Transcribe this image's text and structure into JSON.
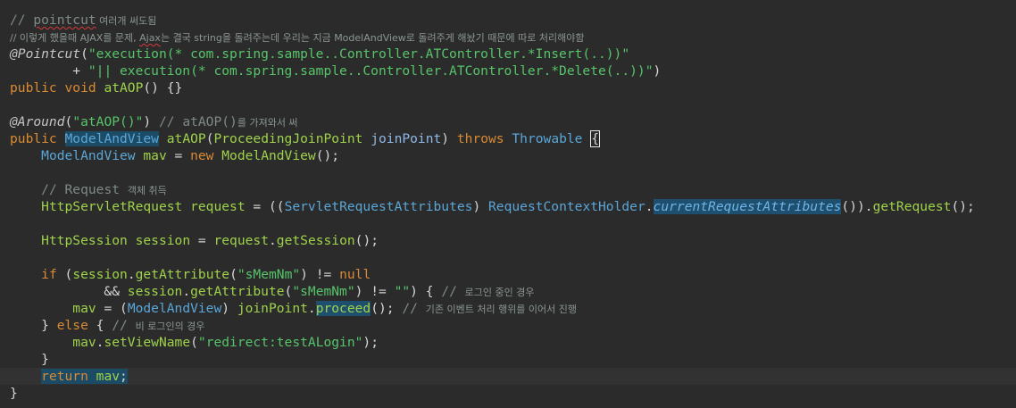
{
  "code": {
    "l1": {
      "a": "// ",
      "b": "pointcut",
      "c": " 여러개 써도됨"
    },
    "l2": {
      "a": "// 이렇게 했을때 AJAX를 문제, ",
      "b": "Ajax",
      "c": "는 결국 string을 돌려주는데 우리는 지금 ModelAndView로 돌려주게 해놨기 때문에 따로 처리해야함"
    },
    "l3": {
      "a": "@Pointcut",
      "b": "(",
      "c": "\"execution(* com.spring.sample..Controller.ATController.*Insert(..))\""
    },
    "l4": {
      "a": "        + ",
      "b": "\"|| execution(* com.spring.sample..Controller.ATController.*Delete(..))\"",
      "c": ")"
    },
    "l5": {
      "a": "public void ",
      "b": "atAOP",
      "c": "() {}"
    },
    "l7": {
      "a": "@Around",
      "b": "(",
      "c": "\"atAOP()\"",
      "d": ") ",
      "e": "// atAOP()",
      "f": "를 가져와서 써"
    },
    "l8": {
      "a": "public ",
      "b": "ModelAndView",
      "c": " ",
      "d": "atAOP",
      "e": "(",
      "f": "ProceedingJoinPoint",
      "g": " ",
      "h": "joinPoint",
      "i": ") ",
      "j": "throws ",
      "k": "Throwable",
      "l": " ",
      "m": "{"
    },
    "l9": {
      "a": "    ",
      "b": "ModelAndView",
      "c": " ",
      "d": "mav",
      "e": " = ",
      "f": "new ",
      "g": "ModelAndView",
      "h": "();"
    },
    "l11": {
      "a": "    ",
      "b": "// Request ",
      "c": "객체 취득"
    },
    "l12": {
      "a": "    ",
      "b": "HttpServletRequest",
      "c": " ",
      "d": "request",
      "e": " = ((",
      "f": "ServletRequestAttributes",
      "g": ") ",
      "h": "RequestContextHolder",
      "i": ".",
      "j": "currentRequestAttributes",
      "k": "()).",
      "l": "getRequest",
      "m": "();"
    },
    "l14": {
      "a": "    ",
      "b": "HttpSession",
      "c": " ",
      "d": "session",
      "e": " = ",
      "f": "request",
      "g": ".",
      "h": "getSession",
      "i": "();"
    },
    "l16": {
      "a": "    ",
      "b": "if",
      "c": " (",
      "d": "session",
      "e": ".",
      "f": "getAttribute",
      "g": "(",
      "h": "\"sMemNm\"",
      "i": ") != ",
      "j": "null"
    },
    "l17": {
      "a": "            && ",
      "b": "session",
      "c": ".",
      "d": "getAttribute",
      "e": "(",
      "f": "\"sMemNm\"",
      "g": ") != ",
      "h": "\"\"",
      "i": ") { ",
      "j": "// ",
      "k": "로그인 중인 경우"
    },
    "l18": {
      "a": "        ",
      "b": "mav",
      "c": " = (",
      "d": "ModelAndView",
      "e": ") ",
      "f": "joinPoint",
      "g": ".",
      "h": "proceed",
      "i": "(); ",
      "j": "// ",
      "k": "기존 이벤트 처리 행위를 이어서 진행"
    },
    "l19": {
      "a": "    } ",
      "b": "else",
      "c": " { ",
      "d": "// ",
      "e": "비 로그인의 경우"
    },
    "l20": {
      "a": "        ",
      "b": "mav",
      "c": ".",
      "d": "setViewName",
      "e": "(",
      "f": "\"redirect:testALogin\"",
      "g": ");"
    },
    "l21": {
      "a": "    }"
    },
    "l22": {
      "a": "    ",
      "b": "return",
      "c": " ",
      "d": "mav",
      "e": ";"
    },
    "l23": {
      "a": "}"
    }
  }
}
